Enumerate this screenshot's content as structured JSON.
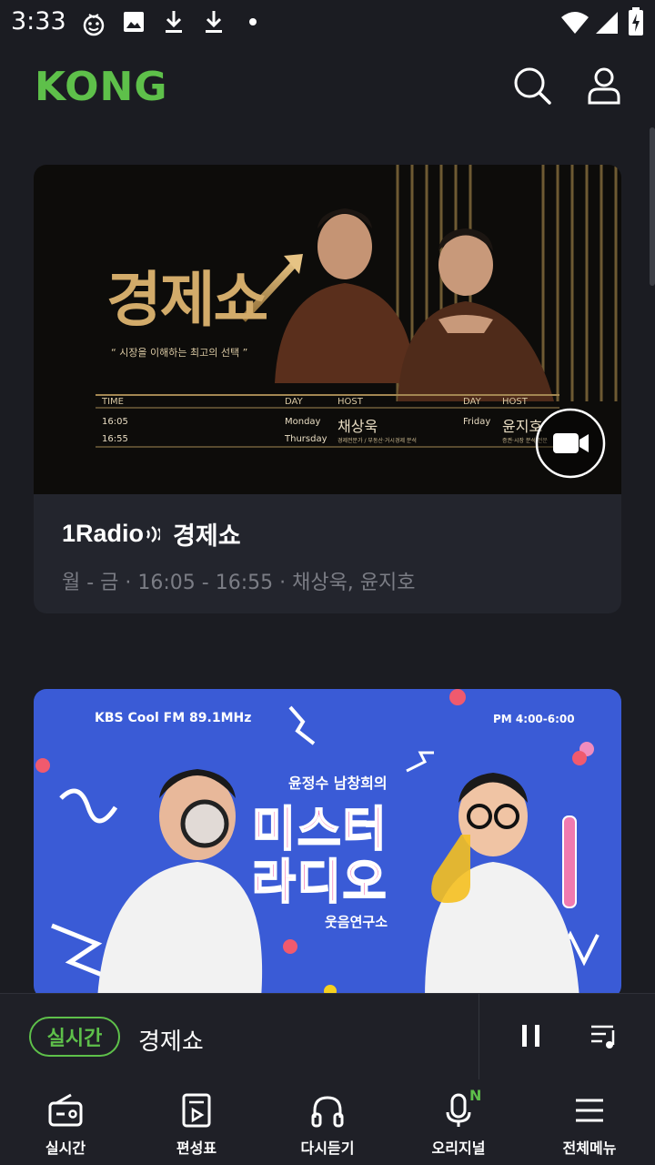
{
  "status_bar": {
    "time": "3:33"
  },
  "app": {
    "logo_text": "KONG"
  },
  "cards": [
    {
      "channel_logo": "1Radio",
      "title": "경제쇼",
      "schedule": "월 - 금 · 16:05 - 16:55 · 채상욱, 윤지호",
      "banner": {
        "show_name": "경제쇼",
        "tagline": "“ 시장을 이해하는 최고의 선택 ”",
        "time_label": "TIME",
        "time_value_start": "16:05",
        "time_value_end": "16:55",
        "day_label": "DAY",
        "host_label": "HOST",
        "day1_start": "Monday",
        "day1_end": "Thursday",
        "host1": "채상욱",
        "host1_desc": "경제전문가 / 부동산·거시경제 분석",
        "day2": "Friday",
        "host2": "윤지호",
        "host2_desc": "증권·시장 분석 전문"
      }
    },
    {
      "banner": {
        "station": "KBS Cool FM 89.1MHz",
        "time": "PM 4:00-6:00",
        "hosts": "윤정수 남창희의",
        "show_line1": "미스터",
        "show_line2": "라디오",
        "subtitle": "웃음연구소"
      }
    }
  ],
  "mini_player": {
    "live_label": "실시간",
    "now_playing": "경제쇼"
  },
  "bottom_nav": [
    {
      "label": "실시간",
      "icon": "radio-icon"
    },
    {
      "label": "편성표",
      "icon": "schedule-icon"
    },
    {
      "label": "다시듣기",
      "icon": "headphones-icon"
    },
    {
      "label": "오리지널",
      "icon": "microphone-icon",
      "badge": "N"
    },
    {
      "label": "전체메뉴",
      "icon": "menu-icon"
    }
  ],
  "colors": {
    "accent": "#5ec04a",
    "background": "#1b1c22",
    "card": "#23252d",
    "muted_text": "#7b7d85"
  }
}
